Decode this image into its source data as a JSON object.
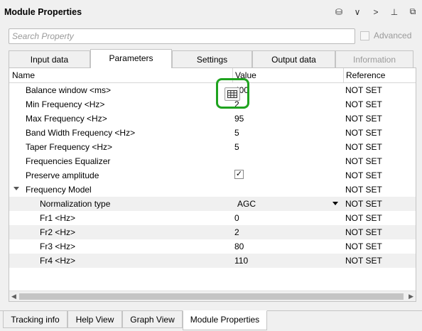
{
  "window": {
    "title": "Module Properties"
  },
  "header_icons": [
    {
      "name": "database-icon",
      "glyph": "⛁"
    },
    {
      "name": "chevron-down-icon",
      "glyph": "∨"
    },
    {
      "name": "chevron-right-icon",
      "glyph": ">"
    },
    {
      "name": "pin-icon",
      "glyph": "⊥"
    },
    {
      "name": "float-window-icon",
      "glyph": "⧉"
    }
  ],
  "search": {
    "placeholder": "Search Property",
    "value": ""
  },
  "advanced": {
    "label": "Advanced",
    "checked": false
  },
  "tabs": [
    {
      "label": "Input data",
      "active": false,
      "disabled": false
    },
    {
      "label": "Parameters",
      "active": true,
      "disabled": false
    },
    {
      "label": "Settings",
      "active": false,
      "disabled": false
    },
    {
      "label": "Output data",
      "active": false,
      "disabled": false
    },
    {
      "label": "Information",
      "active": false,
      "disabled": true
    }
  ],
  "table": {
    "headers": [
      "Name",
      "Value",
      "Reference"
    ],
    "rows": [
      {
        "name": "Balance window <ms>",
        "value": "400",
        "ref": "NOT SET"
      },
      {
        "name": "Min Frequency <Hz>",
        "value": "2",
        "ref": "NOT SET"
      },
      {
        "name": "Max Frequency <Hz>",
        "value": "95",
        "ref": "NOT SET"
      },
      {
        "name": "Band Width Frequency <Hz>",
        "value": "5",
        "ref": "NOT SET"
      },
      {
        "name": "Taper Frequency <Hz>",
        "value": "5",
        "ref": "NOT SET"
      },
      {
        "name": "Frequencies Equalizer",
        "value": "",
        "ref": "NOT SET"
      },
      {
        "name": "Preserve amplitude",
        "value": "",
        "ref": "NOT SET"
      },
      {
        "name": "Frequency Model",
        "value": "",
        "ref": "NOT SET"
      },
      {
        "name": "Normalization type",
        "value": "AGC",
        "ref": "NOT SET"
      },
      {
        "name": "Fr1 <Hz>",
        "value": "0",
        "ref": "NOT SET"
      },
      {
        "name": "Fr2 <Hz>",
        "value": "2",
        "ref": "NOT SET"
      },
      {
        "name": "Fr3 <Hz>",
        "value": "80",
        "ref": "NOT SET"
      },
      {
        "name": "Fr4 <Hz>",
        "value": "110",
        "ref": "NOT SET"
      }
    ]
  },
  "bottom_tabs": [
    {
      "label": "Tracking info",
      "active": false
    },
    {
      "label": "Help View",
      "active": false
    },
    {
      "label": "Graph View",
      "active": false
    },
    {
      "label": "Module Properties",
      "active": true
    }
  ],
  "colors": {
    "highlight": "#1fa31f",
    "disabled_text": "#9a9a9a",
    "alt_row": "#f0f0f0"
  }
}
